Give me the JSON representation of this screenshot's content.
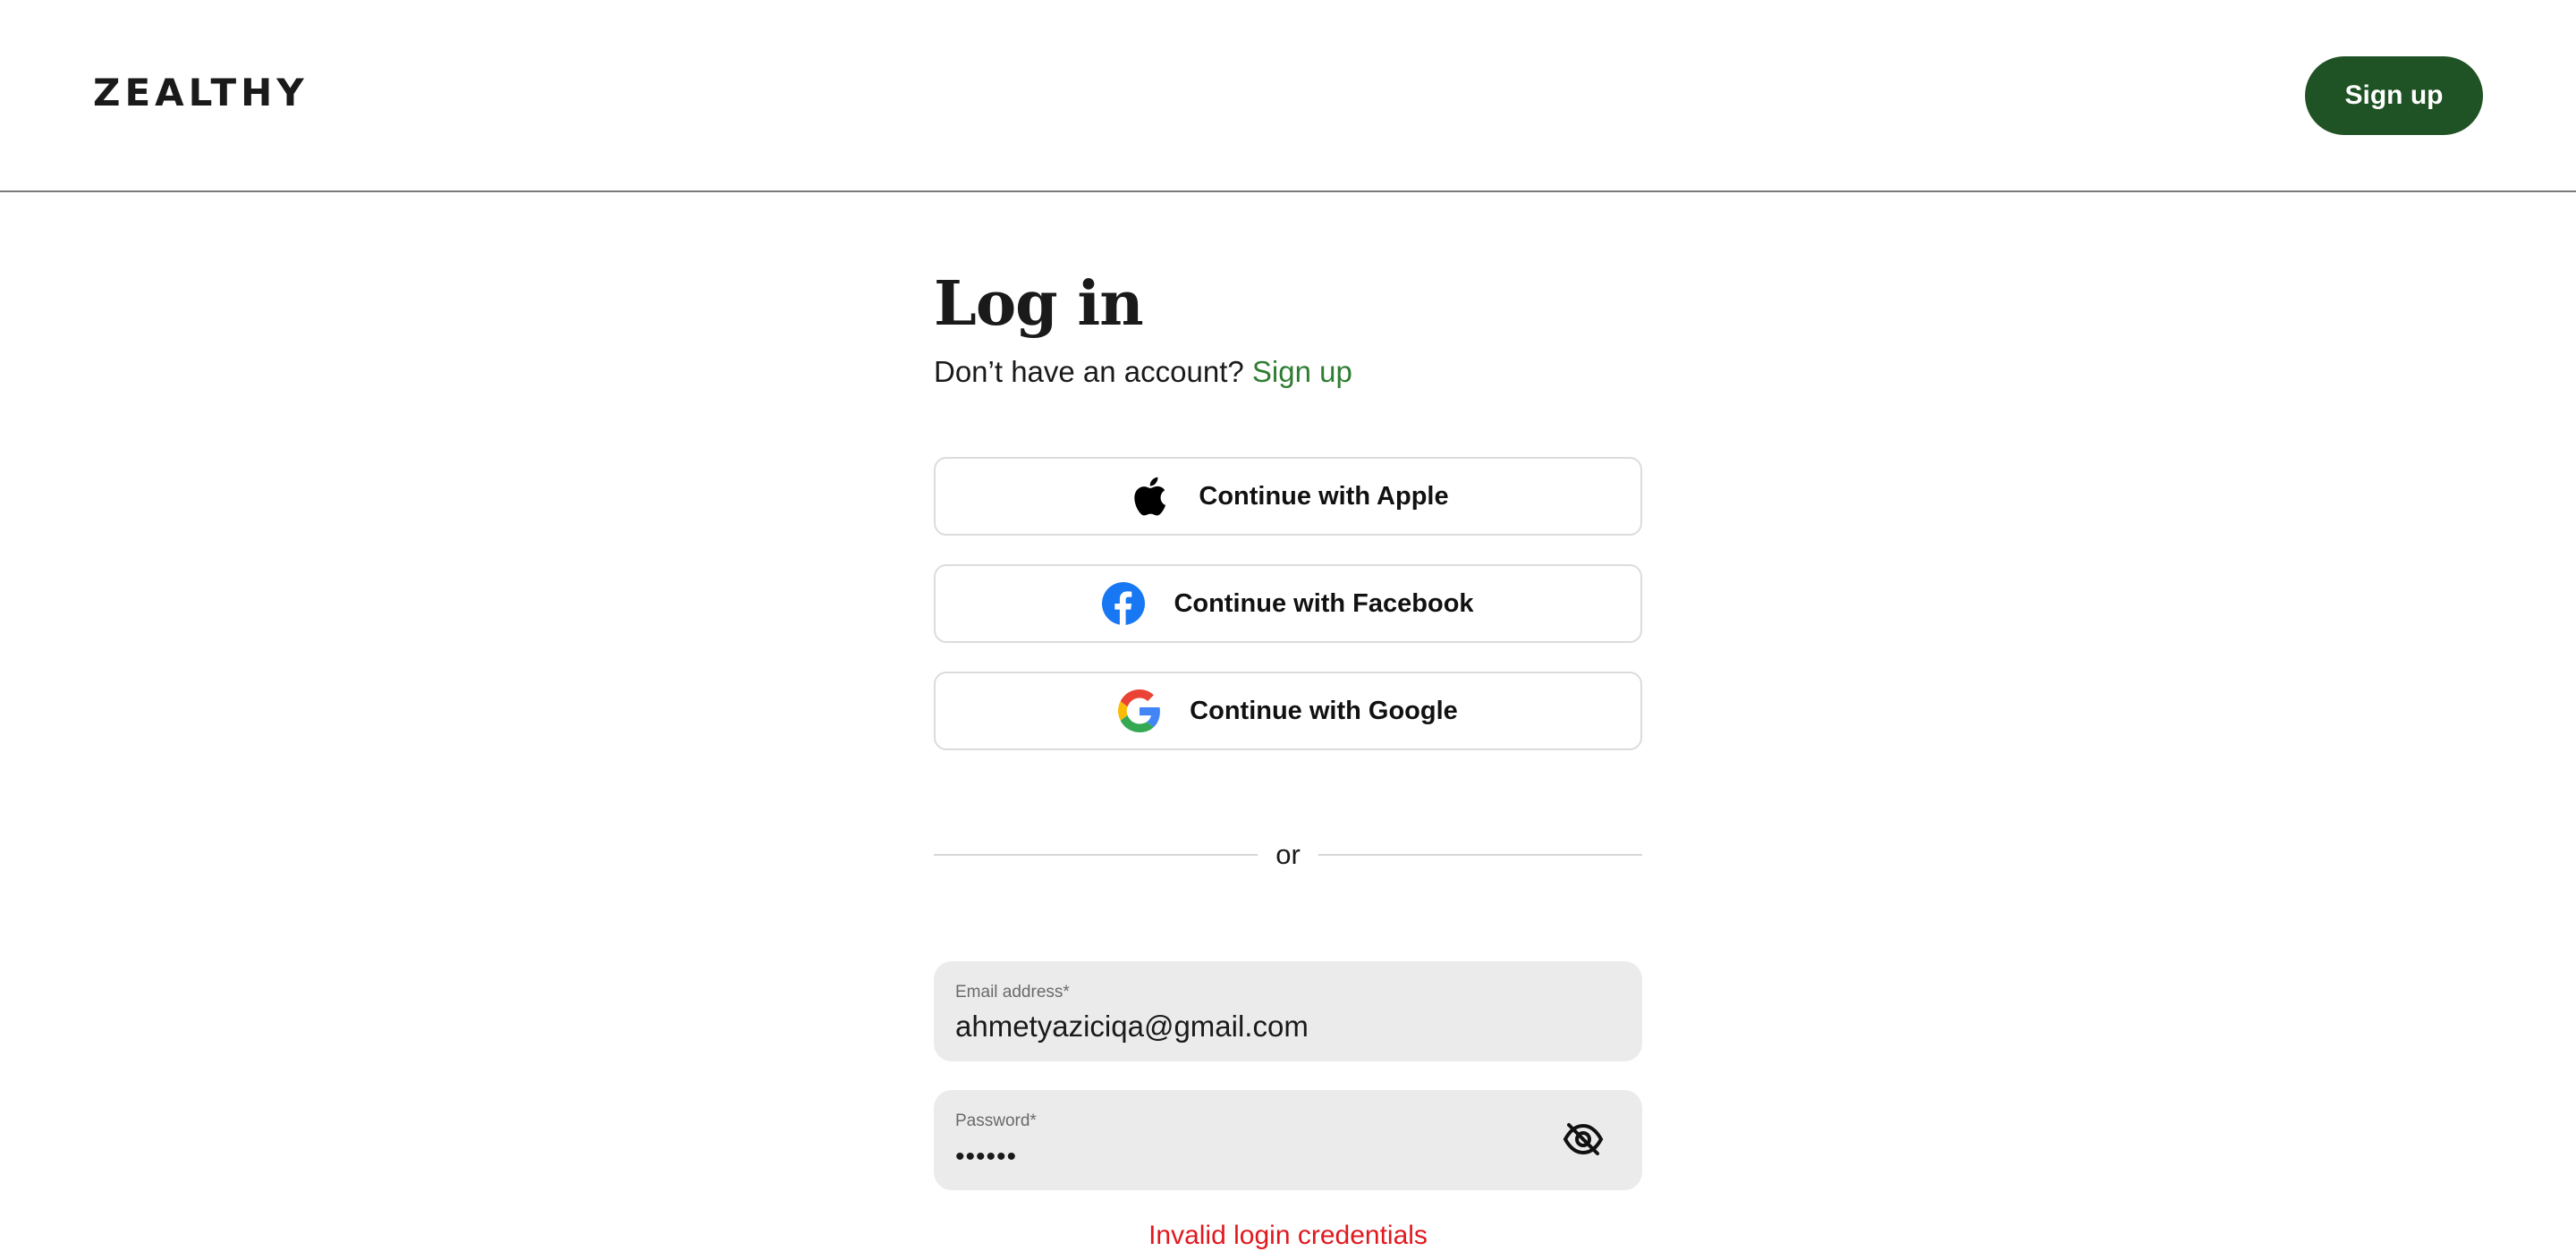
{
  "header": {
    "logo": "ZEALTHY",
    "signup_label": "Sign up"
  },
  "login": {
    "title": "Log in",
    "prompt": "Don’t have an account?",
    "signup_link": "Sign up"
  },
  "social": {
    "apple": "Continue with Apple",
    "facebook": "Continue with Facebook",
    "google": "Continue with Google"
  },
  "divider": {
    "text": "or"
  },
  "form": {
    "email": {
      "label": "Email address",
      "required_mark": "*",
      "value": "ahmetyaziciqa@gmail.com"
    },
    "password": {
      "label": "Password",
      "required_mark": "*",
      "value": "••••••",
      "toggle_icon": "eye-slash-icon"
    },
    "error": "Invalid login credentials"
  },
  "colors": {
    "brand_green": "#1f5224",
    "link_green": "#2e7d32",
    "error_red": "#e0191f",
    "field_bg": "#ebebeb",
    "facebook_blue": "#1877f2"
  },
  "icons": {
    "apple": "apple-icon",
    "facebook": "facebook-icon",
    "google": "google-icon"
  }
}
